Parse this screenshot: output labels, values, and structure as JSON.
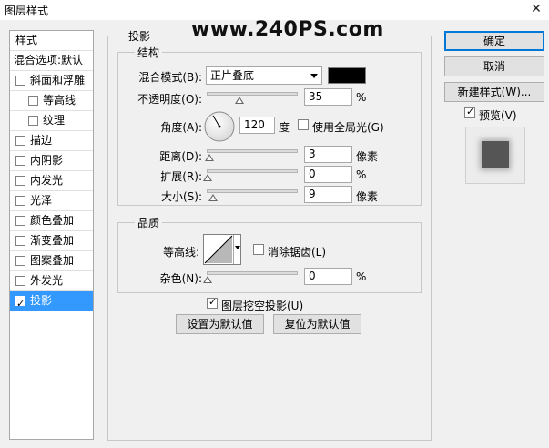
{
  "window": {
    "title": "图层样式",
    "close_glyph": "✕"
  },
  "watermark": "www.240PS.com",
  "styles_list": {
    "header": "样式",
    "blending": "混合选项:默认",
    "items": [
      {
        "label": "斜面和浮雕",
        "checked": false,
        "indent": 0
      },
      {
        "label": "等高线",
        "checked": false,
        "indent": 1
      },
      {
        "label": "纹理",
        "checked": false,
        "indent": 1
      },
      {
        "label": "描边",
        "checked": false,
        "indent": 0
      },
      {
        "label": "内阴影",
        "checked": false,
        "indent": 0
      },
      {
        "label": "内发光",
        "checked": false,
        "indent": 0
      },
      {
        "label": "光泽",
        "checked": false,
        "indent": 0
      },
      {
        "label": "颜色叠加",
        "checked": false,
        "indent": 0
      },
      {
        "label": "渐变叠加",
        "checked": false,
        "indent": 0
      },
      {
        "label": "图案叠加",
        "checked": false,
        "indent": 0
      },
      {
        "label": "外发光",
        "checked": false,
        "indent": 0
      },
      {
        "label": "投影",
        "checked": true,
        "indent": 0,
        "selected": true
      }
    ]
  },
  "drop_shadow": {
    "section_title": "投影",
    "structure": {
      "title": "结构",
      "blend_mode_label": "混合模式(B):",
      "blend_mode_value": "正片叠底",
      "shadow_color": "#000000",
      "opacity_label": "不透明度(O):",
      "opacity_value": "35",
      "opacity_fraction": 0.35,
      "opacity_unit": "%",
      "angle_label": "角度(A):",
      "angle_value": "120",
      "angle_unit": "度",
      "global_light_label": "使用全局光(G)",
      "global_light_checked": false,
      "distance_label": "距离(D):",
      "distance_value": "3",
      "distance_fraction": 0.02,
      "distance_unit": "像素",
      "spread_label": "扩展(R):",
      "spread_value": "0",
      "spread_fraction": 0,
      "spread_unit": "%",
      "size_label": "大小(S):",
      "size_value": "9",
      "size_fraction": 0.06,
      "size_unit": "像素"
    },
    "quality": {
      "title": "品质",
      "contour_label": "等高线:",
      "anti_alias_label": "消除锯齿(L)",
      "anti_alias_checked": false,
      "noise_label": "杂色(N):",
      "noise_value": "0",
      "noise_fraction": 0,
      "noise_unit": "%"
    },
    "knockout_label": "图层挖空投影(U)",
    "knockout_checked": true,
    "make_default_label": "设置为默认值",
    "reset_default_label": "复位为默认值"
  },
  "buttons": {
    "ok": "确定",
    "cancel": "取消",
    "new_style": "新建样式(W)...",
    "preview_label": "预览(V)",
    "preview_checked": true
  }
}
